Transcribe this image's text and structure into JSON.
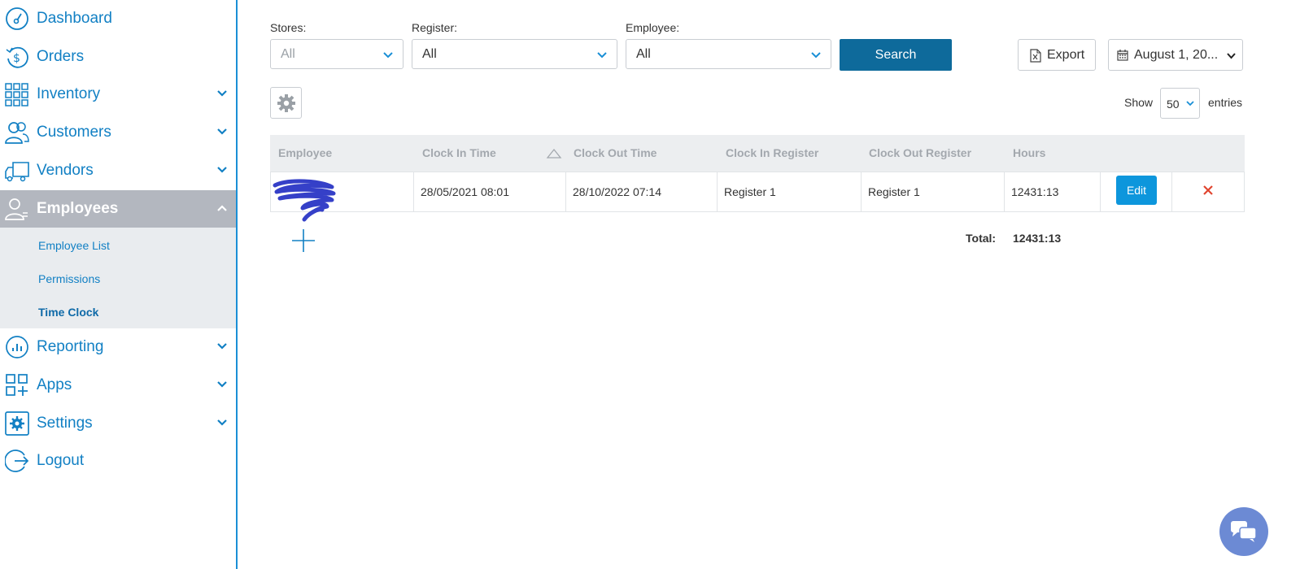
{
  "sidebar": {
    "items": [
      {
        "label": "Dashboard",
        "icon": "dashboard-icon"
      },
      {
        "label": "Orders",
        "icon": "orders-dollar-icon"
      },
      {
        "label": "Inventory",
        "icon": "grid-icon"
      },
      {
        "label": "Customers",
        "icon": "customers-icon"
      },
      {
        "label": "Vendors",
        "icon": "truck-icon"
      },
      {
        "label": "Employees",
        "icon": "employees-icon"
      },
      {
        "label": "Reporting",
        "icon": "chart-icon"
      },
      {
        "label": "Apps",
        "icon": "apps-icon"
      },
      {
        "label": "Settings",
        "icon": "gear-icon"
      },
      {
        "label": "Logout",
        "icon": "logout-icon"
      }
    ],
    "submenu": [
      "Employee List",
      "Permissions",
      "Time Clock"
    ]
  },
  "filters": {
    "stores_label": "Stores:",
    "stores_value": "All",
    "register_label": "Register:",
    "register_value": "All",
    "employee_label": "Employee:",
    "employee_value": "All",
    "search_label": "Search",
    "export_label": "Export",
    "date_label": "August 1, 20..."
  },
  "entries": {
    "show": "Show",
    "page_size": "50",
    "entries": "entries"
  },
  "table": {
    "headers": [
      "Employee",
      "Clock In Time",
      "Clock Out Time",
      "Clock In Register",
      "Clock Out Register",
      "Hours"
    ],
    "row": {
      "employee": "",
      "clock_in": "28/05/2021 08:01",
      "clock_out": "28/10/2022 07:14",
      "clock_in_register": "Register 1",
      "clock_out_register": "Register 1",
      "hours": "12431:13",
      "edit_label": "Edit"
    },
    "total_label": "Total:",
    "total_value": "12431:13"
  },
  "colors": {
    "accent": "#1280c4",
    "search_button": "#0e6a9b",
    "edit_button": "#0d96dc",
    "delete": "#e0452f",
    "active_nav": "#b3b7bf"
  }
}
